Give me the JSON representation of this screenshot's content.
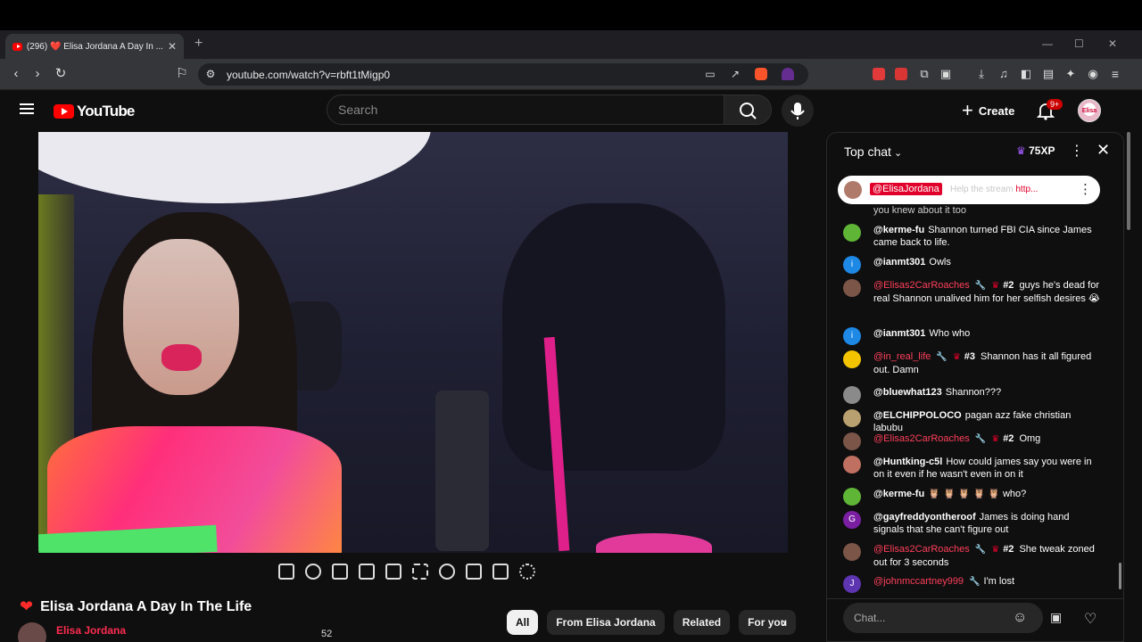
{
  "browser": {
    "tab_title": "(296) ❤️ Elisa Jordana A Day In ...",
    "url": "youtube.com/watch?v=rbft1tMigp0"
  },
  "youtube": {
    "logo_text": "YouTube",
    "search_placeholder": "Search",
    "create_label": "Create",
    "notification_count": "9+",
    "avatar_text": "Elisa"
  },
  "video": {
    "title": "Elisa Jordana A Day In The Life",
    "channel": "Elisa Jordana",
    "likes": "52"
  },
  "chips": [
    "All",
    "From Elisa Jordana",
    "Related",
    "For you"
  ],
  "chat": {
    "title": "Top chat",
    "xp": "75XP",
    "pinned_author": "@ElisaJordana",
    "pinned_text": "Help the stream ",
    "pinned_link": "http...",
    "partial_top_text": "you knew about it too",
    "messages": [
      {
        "author": "@kerme-fu",
        "text": "Shannon turned FBI CIA since James came back to life.",
        "avatar_color": "#5fb636",
        "avatar_letter": ""
      },
      {
        "author": "@ianmt301",
        "text": "Owls",
        "avatar_color": "#1e88e5",
        "avatar_letter": "i"
      },
      {
        "author": "@Elisas2CarRoaches",
        "rank": "#2",
        "text": "guys he's dead for real Shannon unalived him for her selfish desires 😭",
        "avatar_color": "#7a5548",
        "avatar_letter": ""
      },
      {
        "author": "@ianmt301",
        "text": "Who who",
        "avatar_color": "#1e88e5",
        "avatar_letter": "i"
      },
      {
        "author": "@in_real_life",
        "rank": "#3",
        "text": "Shannon has it all figured out. Damn",
        "avatar_color": "#f5c400",
        "avatar_letter": ""
      },
      {
        "author": "@bluewhat123",
        "text": "Shannon???",
        "avatar_color": "#8a8a8a",
        "avatar_letter": ""
      },
      {
        "author": "@ELCHIPPOLOCO",
        "text": "pagan azz fake christian labubu",
        "avatar_color": "#b8a070",
        "avatar_letter": ""
      },
      {
        "author": "@Elisas2CarRoaches",
        "rank": "#2",
        "text": "Omg",
        "avatar_color": "#7a5548",
        "avatar_letter": ""
      },
      {
        "author": "@Huntking-c5l",
        "text": "How could james say you were in on it even if he wasn't even in on it",
        "avatar_color": "#c07060",
        "avatar_letter": ""
      },
      {
        "author": "@kerme-fu",
        "text": "🦉 🦉 🦉 🦉 🦉 who?",
        "avatar_color": "#5fb636",
        "avatar_letter": ""
      },
      {
        "author": "@gayfreddyontheroof",
        "text": "James is doing hand signals that she can't figure out",
        "avatar_color": "#7b1fa2",
        "avatar_letter": "G"
      },
      {
        "author": "@Elisas2CarRoaches",
        "rank": "#2",
        "text": "She tweak zoned out for 3 seconds",
        "avatar_color": "#7a5548",
        "avatar_letter": ""
      },
      {
        "author": "@johnmccartney999",
        "text": "I'm lost",
        "avatar_color": "#5e35b1",
        "avatar_letter": "J"
      }
    ],
    "input_placeholder": "Chat..."
  }
}
